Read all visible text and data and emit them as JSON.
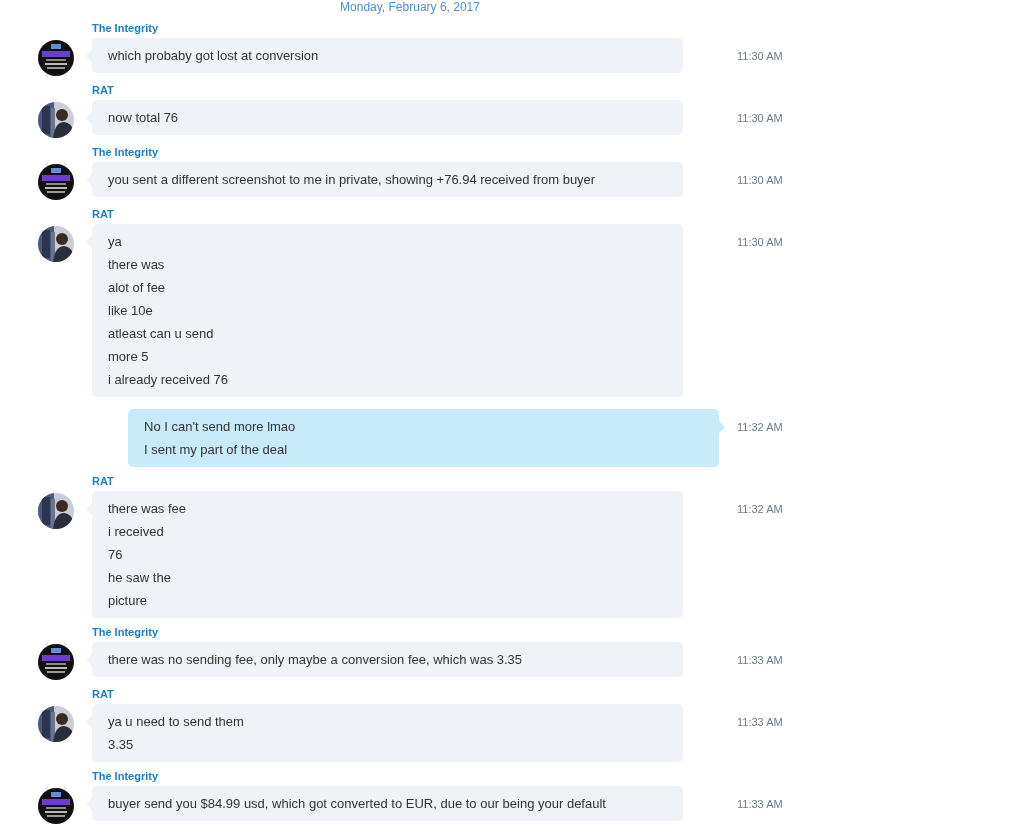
{
  "date_header": "Monday, February 6, 2017",
  "messages": [
    {
      "kind": "incoming",
      "sender": "The Integrity",
      "avatar": {
        "kind": "picture"
      },
      "lines": [
        "which probaby got lost at conversion"
      ],
      "time": "11:30 AM"
    },
    {
      "kind": "incoming",
      "sender": "RAT",
      "avatar": {
        "kind": "picture"
      },
      "lines": [
        "now total 76"
      ],
      "time": "11:30 AM"
    },
    {
      "kind": "incoming",
      "sender": "The Integrity",
      "avatar": {
        "kind": "picture"
      },
      "lines": [
        "you sent a different screenshot to me in private, showing +76.94 received from buyer"
      ],
      "time": "11:30 AM"
    },
    {
      "kind": "incoming",
      "sender": "RAT",
      "avatar": {
        "kind": "picture"
      },
      "lines": [
        "ya",
        "there was",
        "alot of fee",
        "like 10e",
        "atleast can u send",
        "more 5",
        "i already received 76"
      ],
      "time": "11:30 AM"
    },
    {
      "kind": "outgoing",
      "lines": [
        "No I can't send more lmao",
        "I sent my part of the deal"
      ],
      "time": "11:32 AM"
    },
    {
      "kind": "incoming",
      "sender": "RAT",
      "avatar": {
        "kind": "picture"
      },
      "lines": [
        "there was fee",
        "i received",
        "76",
        "he saw the",
        "picture"
      ],
      "time": "11:32 AM"
    },
    {
      "kind": "incoming",
      "sender": "The Integrity",
      "avatar": {
        "kind": "picture"
      },
      "lines": [
        "there was no sending fee, only maybe a conversion fee, which was 3.35"
      ],
      "time": "11:33 AM"
    },
    {
      "kind": "incoming",
      "sender": "RAT",
      "avatar": {
        "kind": "picture"
      },
      "lines": [
        "ya u need to send them",
        "3.35"
      ],
      "time": "11:33 AM"
    },
    {
      "kind": "incoming",
      "sender": "The Integrity",
      "avatar": {
        "kind": "picture"
      },
      "lines": [
        "buyer send you $84.99 usd, which got converted to EUR, due to our being your default"
      ],
      "time": "11:33 AM"
    }
  ]
}
